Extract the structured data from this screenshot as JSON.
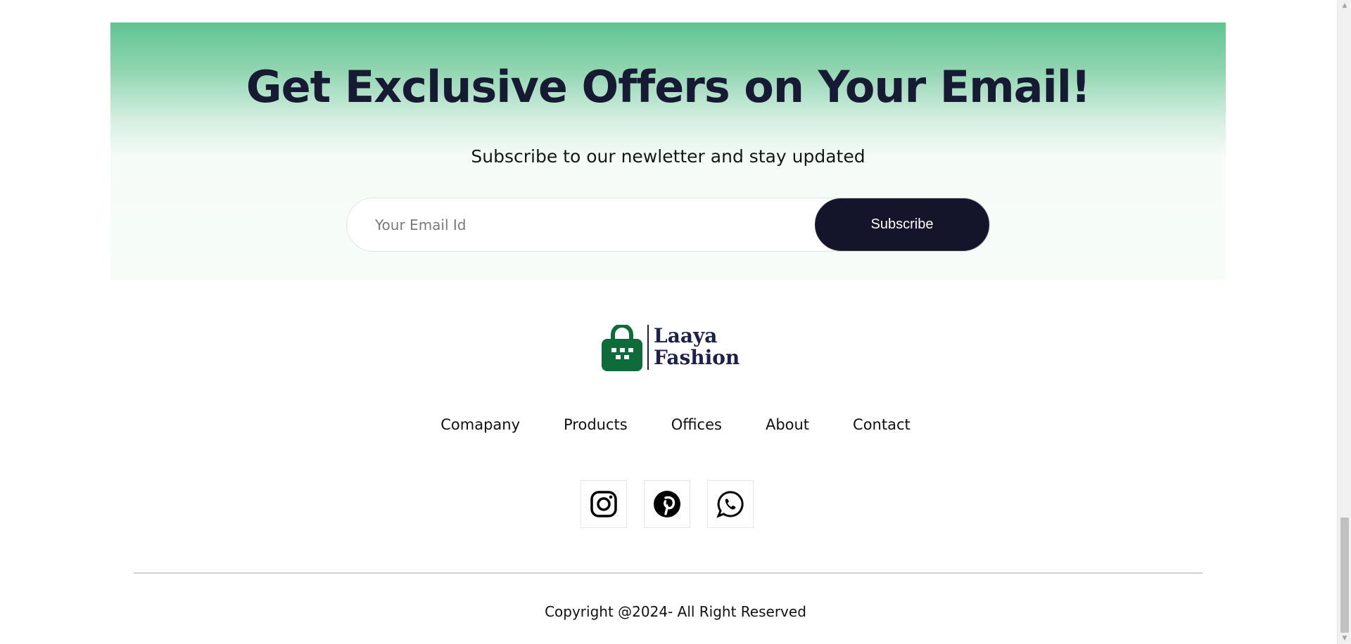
{
  "newsletter": {
    "title": "Get Exclusive Offers on Your Email!",
    "subtitle": "Subscribe to our newletter and stay updated",
    "email_placeholder": "Your Email Id",
    "subscribe_label": "Subscribe"
  },
  "logo": {
    "line1": "Laaya",
    "line2": "Fashion",
    "icon": "shopping-bag-icon"
  },
  "nav": {
    "items": [
      "Comapany",
      "Products",
      "Offices",
      "About",
      "Contact"
    ]
  },
  "social": {
    "icons": [
      "instagram-icon",
      "pinterest-icon",
      "whatsapp-icon"
    ]
  },
  "footer": {
    "copyright": "Copyright @2024- All Right Reserved"
  },
  "colors": {
    "brand_green": "#5fc591",
    "dark_navy": "#14142b",
    "logo_green": "#0e6b3a",
    "logo_navy": "#1d1f4d"
  }
}
